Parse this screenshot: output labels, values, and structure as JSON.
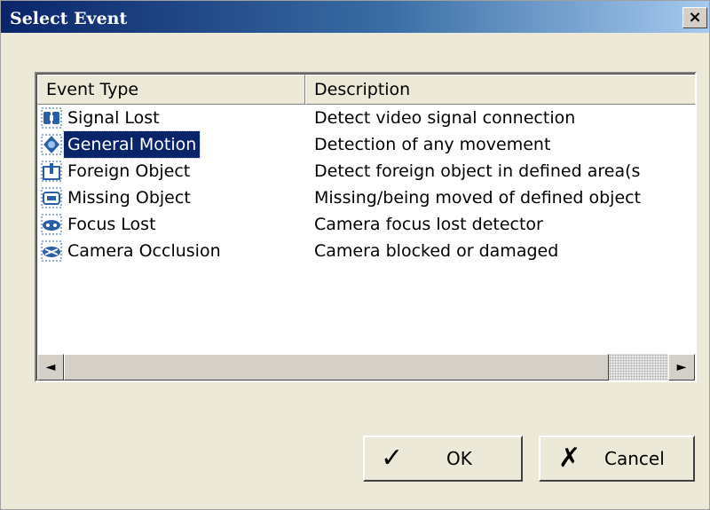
{
  "window": {
    "title": "Select Event",
    "close_glyph": "×"
  },
  "list": {
    "columns": {
      "type": "Event Type",
      "description": "Description"
    },
    "selected_index": 1,
    "rows": [
      {
        "icon": "signal-lost-icon",
        "type": "Signal Lost",
        "description": "Detect video signal connection"
      },
      {
        "icon": "general-motion-icon",
        "type": "General Motion",
        "description": "Detection of any movement"
      },
      {
        "icon": "foreign-object-icon",
        "type": "Foreign Object",
        "description": "Detect foreign object in defined area(s"
      },
      {
        "icon": "missing-object-icon",
        "type": "Missing Object",
        "description": "Missing/being moved of defined object"
      },
      {
        "icon": "focus-lost-icon",
        "type": "Focus Lost",
        "description": "Camera focus lost detector"
      },
      {
        "icon": "camera-occlusion-icon",
        "type": "Camera Occlusion",
        "description": "Camera blocked or damaged"
      }
    ],
    "scrollbar": {
      "left_arrow": "◄",
      "right_arrow": "►"
    }
  },
  "buttons": {
    "ok": {
      "label": "OK",
      "glyph": "✓"
    },
    "cancel": {
      "label": "Cancel",
      "glyph": "✗"
    }
  },
  "colors": {
    "title_start": "#0a246a",
    "title_end": "#a6caf0",
    "selection": "#0a246a",
    "icon_blue": "#2a5fa8"
  }
}
